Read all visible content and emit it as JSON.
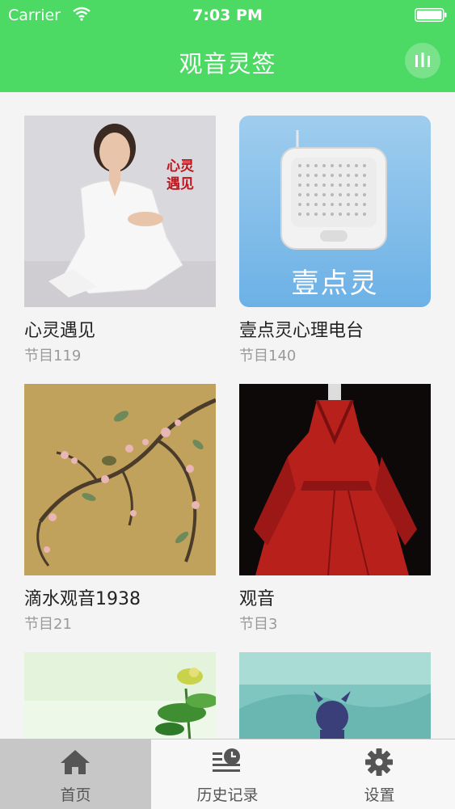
{
  "status_bar": {
    "carrier": "Carrier",
    "time": "7:03 PM"
  },
  "header": {
    "title": "观音灵签"
  },
  "colors": {
    "accent": "#4cd964",
    "tab_active_bg": "#c7c7c7"
  },
  "albums": [
    {
      "name": "心灵遇见",
      "count": "节目119",
      "image_text": "心灵遇见"
    },
    {
      "name": "壹点灵心理电台",
      "count": "节目140",
      "image_text": "壹点灵"
    },
    {
      "name": "滴水观音1938",
      "count": "节目21"
    },
    {
      "name": "观音",
      "count": "节目3"
    },
    {
      "name": "",
      "count": ""
    },
    {
      "name": "",
      "count": ""
    }
  ],
  "tabs": [
    {
      "label": "首页",
      "icon": "home-icon",
      "active": true
    },
    {
      "label": "历史记录",
      "icon": "history-icon",
      "active": false
    },
    {
      "label": "设置",
      "icon": "settings-gear-icon",
      "active": false
    }
  ]
}
